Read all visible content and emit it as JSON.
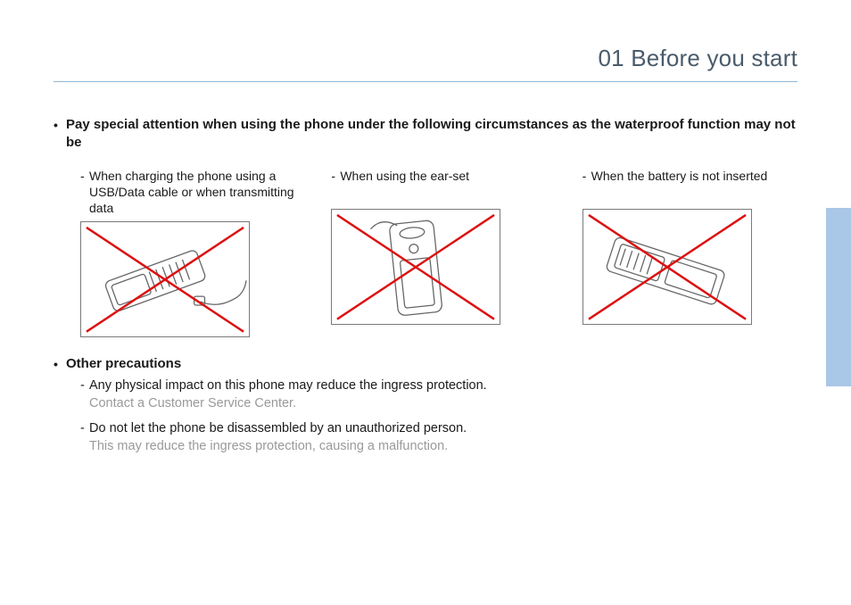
{
  "chapter": {
    "title": "01 Before you start"
  },
  "intro": {
    "bullet_glyph": "•",
    "text": "Pay special attention when using the phone under the following circumstances as the waterproof function may not be"
  },
  "columns": [
    {
      "caption": "When charging the phone using a USB/Data cable or when transmitting data"
    },
    {
      "caption": "When using the ear-set"
    },
    {
      "caption": "When the battery is not inserted"
    }
  ],
  "other": {
    "heading": "Other precautions",
    "items": [
      {
        "text": "Any physical impact on this phone may reduce the ingress protection.",
        "note": "Contact a Customer Service Center."
      },
      {
        "text": "Do not let the phone be disassembled by an unauthorized person.",
        "note": "This may reduce the ingress protection, causing a malfunction."
      }
    ]
  },
  "glyphs": {
    "dash": "-"
  }
}
